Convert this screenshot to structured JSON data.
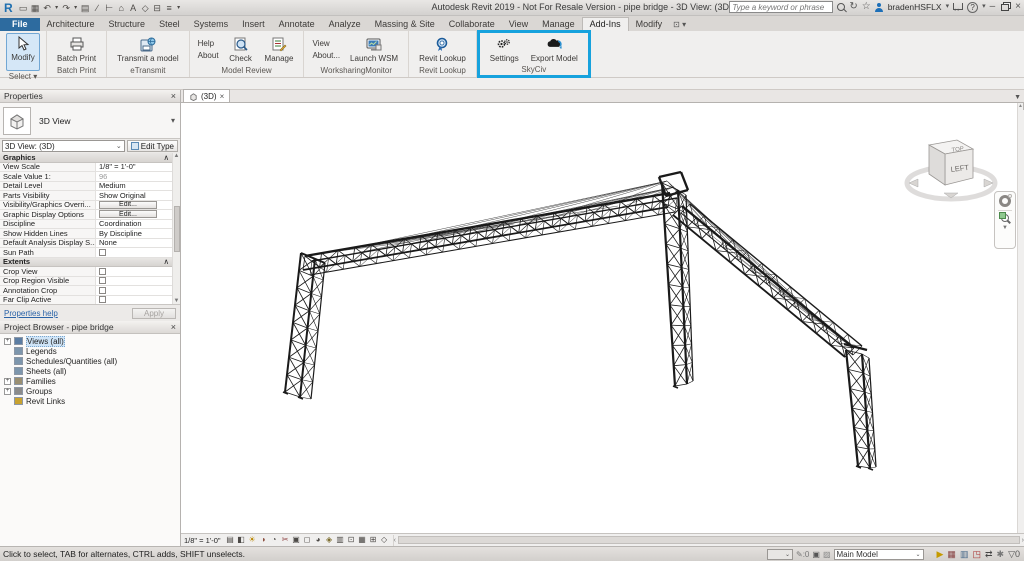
{
  "window": {
    "title": "Autodesk Revit 2019 - Not For Resale Version - pipe bridge - 3D View: (3D)",
    "search_placeholder": "Type a keyword or phrase",
    "username": "bradenHSFLX",
    "minimize": "–",
    "close": "×"
  },
  "qat": [
    {
      "name": "open-icon",
      "glyph": "▭"
    },
    {
      "name": "save-icon",
      "glyph": "▦"
    },
    {
      "name": "undo-icon",
      "glyph": "↶"
    },
    {
      "name": "undo-caret-icon",
      "glyph": "▾"
    },
    {
      "name": "redo-icon",
      "glyph": "↷"
    },
    {
      "name": "redo-caret-icon",
      "glyph": "▾"
    },
    {
      "name": "print-icon",
      "glyph": "▤"
    },
    {
      "name": "measure-icon",
      "glyph": "∕"
    },
    {
      "name": "aligned-dimension-icon",
      "glyph": "⊢"
    },
    {
      "name": "tag-icon",
      "glyph": "⌂"
    },
    {
      "name": "text-icon",
      "glyph": "A"
    },
    {
      "name": "default-3d-view-icon",
      "glyph": "◇"
    },
    {
      "name": "section-icon",
      "glyph": "⊟"
    },
    {
      "name": "thin-lines-icon",
      "glyph": "≡"
    },
    {
      "name": "qat-customize-icon",
      "glyph": "▾"
    }
  ],
  "ribbon": {
    "tabs": [
      {
        "label": "File",
        "type": "file"
      },
      {
        "label": "Architecture"
      },
      {
        "label": "Structure"
      },
      {
        "label": "Steel"
      },
      {
        "label": "Systems"
      },
      {
        "label": "Insert"
      },
      {
        "label": "Annotate"
      },
      {
        "label": "Analyze"
      },
      {
        "label": "Massing & Site"
      },
      {
        "label": "Collaborate"
      },
      {
        "label": "View"
      },
      {
        "label": "Manage"
      },
      {
        "label": "Add-Ins",
        "active": true
      },
      {
        "label": "Modify"
      }
    ],
    "panels": {
      "select": {
        "label": "Select",
        "caret": "▾",
        "button": "Modify"
      },
      "batch_print": {
        "label": "Batch Print",
        "button": "Batch Print"
      },
      "etransmit": {
        "label": "eTransmit",
        "button": "Transmit a model"
      },
      "model_review": {
        "label": "Model Review",
        "small": [
          "Help",
          "About"
        ],
        "check": "Check",
        "manage": "Manage"
      },
      "wsm": {
        "label": "WorksharingMonitor",
        "small": [
          "View",
          "About..."
        ],
        "button": "Launch WSM"
      },
      "lookup": {
        "label": "Revit Lookup",
        "button": "Revit Lookup"
      },
      "skyciv": {
        "label": "SkyCiv",
        "settings": "Settings",
        "export": "Export Model",
        "highlight_color": "#17a2dd"
      }
    }
  },
  "properties": {
    "title": "Properties",
    "type_name": "3D View",
    "view_selector": "3D View: (3D)",
    "edit_type": "Edit Type",
    "grid": [
      {
        "section": "Graphics"
      },
      {
        "label": "View Scale",
        "value": "1/8\" = 1'-0\"",
        "kind": "text"
      },
      {
        "label": "Scale Value    1:",
        "value": "96",
        "kind": "muted"
      },
      {
        "label": "Detail Level",
        "value": "Medium",
        "kind": "text"
      },
      {
        "label": "Parts Visibility",
        "value": "Show Original",
        "kind": "text"
      },
      {
        "label": "Visibility/Graphics Overri...",
        "value": "Edit...",
        "kind": "button"
      },
      {
        "label": "Graphic Display Options",
        "value": "Edit...",
        "kind": "button"
      },
      {
        "label": "Discipline",
        "value": "Coordination",
        "kind": "text"
      },
      {
        "label": "Show Hidden Lines",
        "value": "By Discipline",
        "kind": "text"
      },
      {
        "label": "Default Analysis Display S...",
        "value": "None",
        "kind": "text"
      },
      {
        "label": "Sun Path",
        "kind": "checkbox"
      },
      {
        "section": "Extents"
      },
      {
        "label": "Crop View",
        "kind": "checkbox"
      },
      {
        "label": "Crop Region Visible",
        "kind": "checkbox"
      },
      {
        "label": "Annotation Crop",
        "kind": "checkbox"
      },
      {
        "label": "Far Clip Active",
        "kind": "checkbox"
      }
    ],
    "help_link": "Properties help",
    "apply_label": "Apply"
  },
  "project_browser": {
    "title": "Project Browser - pipe bridge",
    "items": [
      {
        "label": "Views (all)",
        "expand": true,
        "selected": true,
        "icon": "views-icon",
        "icon_color": "#5b7da3"
      },
      {
        "label": "Legends",
        "icon": "legends-icon",
        "icon_color": "#7d96ad"
      },
      {
        "label": "Schedules/Quantities (all)",
        "icon": "schedules-icon",
        "icon_color": "#7d96ad"
      },
      {
        "label": "Sheets (all)",
        "icon": "sheets-icon",
        "icon_color": "#7d96ad"
      },
      {
        "label": "Families",
        "expand": true,
        "icon": "families-icon",
        "icon_color": "#9a8f72"
      },
      {
        "label": "Groups",
        "expand": true,
        "icon": "groups-icon",
        "icon_color": "#8b8b8b"
      },
      {
        "label": "Revit Links",
        "icon": "revit-links-icon",
        "icon_color": "#c8a230"
      }
    ]
  },
  "canvas": {
    "tab_label": "(3D)",
    "viewcube_front": "LEFT",
    "viewcube_top": "TOP",
    "scale_label": "1/8\" = 1'-0\""
  },
  "view_controls": [
    {
      "name": "scale-control",
      "glyph": ""
    },
    {
      "name": "detail-level-icon",
      "glyph": "▤",
      "color": "#4d4a47"
    },
    {
      "name": "visual-style-icon",
      "glyph": "◧",
      "color": "#4d4a47"
    },
    {
      "name": "sun-path-icon",
      "glyph": "☀",
      "color": "#b98600"
    },
    {
      "name": "shadows-icon",
      "glyph": "◑",
      "color": "#8a4a3a"
    },
    {
      "name": "sun-settings-icon",
      "glyph": "◔",
      "color": "#4d4a47"
    },
    {
      "name": "crop-view-icon",
      "glyph": "✂",
      "color": "#8a3a3a"
    },
    {
      "name": "show-crop-icon",
      "glyph": "▣",
      "color": "#4d4a47"
    },
    {
      "name": "lock-3d-icon",
      "glyph": "◻",
      "color": "#4d4a47"
    },
    {
      "name": "temporary-hide-isolate-icon",
      "glyph": "◕",
      "color": "#4d4a47"
    },
    {
      "name": "reveal-hidden-icon",
      "glyph": "◈",
      "color": "#7a6a2a"
    },
    {
      "name": "temporary-view-properties-icon",
      "glyph": "▥",
      "color": "#4d4a47"
    },
    {
      "name": "analytical-model-icon",
      "glyph": "⊡",
      "color": "#4d4a47"
    },
    {
      "name": "highlight-sets-icon",
      "glyph": "▦",
      "color": "#4d4a47"
    },
    {
      "name": "displacement-icon",
      "glyph": "⊞",
      "color": "#4d4a47"
    },
    {
      "name": "constraints-icon",
      "glyph": "◇",
      "color": "#4d4a47"
    }
  ],
  "statusbar": {
    "prompt": "Click to select, TAB for alternates, CTRL adds, SHIFT unselects.",
    "workset_pencil": "✎",
    "workset_count": ":0",
    "main_model": "Main Model",
    "right_icons": [
      {
        "name": "worksharing-display-icon",
        "glyph": "▶",
        "color": "#c59a00"
      },
      {
        "name": "editable-only-icon",
        "glyph": "▦",
        "color": "#884444"
      },
      {
        "name": "links-select-icon",
        "glyph": "▥",
        "color": "#446688"
      },
      {
        "name": "underlay-select-icon",
        "glyph": "◳",
        "color": "#aa3333"
      },
      {
        "name": "pinned-select-icon",
        "glyph": "⇄",
        "color": "#444444"
      },
      {
        "name": "drag-on-selection-icon",
        "glyph": "✱",
        "color": "#777777"
      },
      {
        "name": "filter-icon",
        "glyph": "▽",
        "color": "#555555",
        "badge": "0"
      }
    ]
  }
}
